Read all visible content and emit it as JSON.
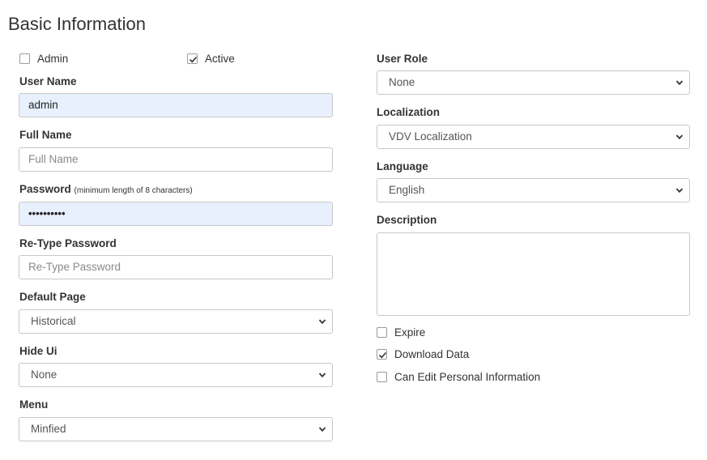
{
  "page": {
    "title": "Basic Information"
  },
  "left": {
    "admin_checkbox": {
      "label": "Admin",
      "checked": false
    },
    "active_checkbox": {
      "label": "Active",
      "checked": true
    },
    "user_name": {
      "label": "User Name",
      "value": "admin"
    },
    "full_name": {
      "label": "Full Name",
      "placeholder": "Full Name",
      "value": ""
    },
    "password": {
      "label": "Password",
      "hint": "(minimum length of 8 characters)",
      "value_masked": "••••••••••"
    },
    "retype_password": {
      "label": "Re-Type Password",
      "placeholder": "Re-Type Password",
      "value": ""
    },
    "default_page": {
      "label": "Default Page",
      "selected": "Historical"
    },
    "hide_ui": {
      "label": "Hide Ui",
      "selected": "None"
    },
    "menu": {
      "label": "Menu",
      "selected": "Minfied"
    }
  },
  "right": {
    "user_role": {
      "label": "User Role",
      "selected": "None"
    },
    "localization": {
      "label": "Localization",
      "selected": "VDV Localization"
    },
    "language": {
      "label": "Language",
      "selected": "English"
    },
    "description": {
      "label": "Description",
      "value": ""
    },
    "expire_checkbox": {
      "label": "Expire",
      "checked": false
    },
    "download_data_checkbox": {
      "label": "Download Data",
      "checked": true
    },
    "can_edit_personal_checkbox": {
      "label": "Can Edit Personal Information",
      "checked": false
    }
  },
  "icons": {
    "select_arrow": "chevron-down-icon",
    "check": "check-icon"
  }
}
